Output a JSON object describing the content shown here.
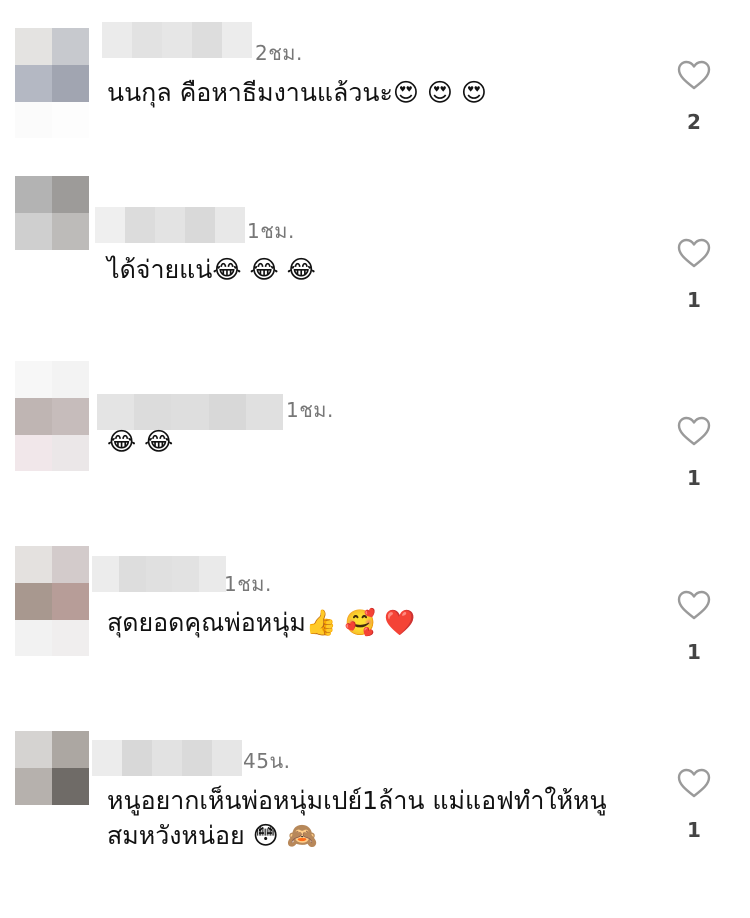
{
  "comments": [
    {
      "time": "2ชม.",
      "text": "นนกุล คือหาธีมงานแล้วนะ😍 😍 😍",
      "likes": "2",
      "avatar_colors": [
        "#e4e3e1",
        "#c7c9ce",
        "#b4b8c3",
        "#a1a5b1",
        "#fbfbfb",
        "#fdfdfd"
      ],
      "name_colors": [
        "#ebebeb",
        "#e2e2e2",
        "#e6e6e6",
        "#dddddd",
        "#ececec"
      ]
    },
    {
      "time": "1ชม.",
      "text": "ได้จ่ายแน่😂 😂 😂",
      "likes": "1",
      "avatar_colors": [
        "#b3b3b3",
        "#9d9b99",
        "#cfcfcf",
        "#bdbbb9",
        "#ffffff",
        "#ffffff"
      ],
      "name_colors": [
        "#efefef",
        "#dcdcdc",
        "#e3e3e3",
        "#d9d9d9",
        "#e8e8e8"
      ]
    },
    {
      "time": "1ชม.",
      "text": "😂 😂",
      "likes": "1",
      "avatar_colors": [
        "#f7f7f7",
        "#f3f3f3",
        "#bfb5b3",
        "#c6bcbb",
        "#f1e7ea",
        "#ebe7e8"
      ],
      "name_colors": [
        "#e4e4e4",
        "#dcdcdc",
        "#dedede",
        "#d8d8d8",
        "#e0e0e0"
      ]
    },
    {
      "time": "1ชม.",
      "text": "สุดยอดคุณพ่อหนุ่ม👍 🥰 ❤️",
      "likes": "1",
      "avatar_colors": [
        "#e4e1df",
        "#d3cbcb",
        "#a8988f",
        "#b79d98",
        "#f2f2f2",
        "#f0eeee"
      ],
      "name_colors": [
        "#ececec",
        "#dddddd",
        "#e0e0e0",
        "#e2e2e2",
        "#eaeaea"
      ]
    },
    {
      "time": "45น.",
      "text_lines": [
        "หนูอยากเห็นพ่อหนุ่มเปย์1ล้าน แม่แอฟทำให้หนู",
        "สมหวังหน่อย 😳 🙈"
      ],
      "likes": "1",
      "avatar_colors": [
        "#d5d3d1",
        "#aca7a2",
        "#b6b1ad",
        "#6f6b67",
        "#ffffff",
        "#ffffff"
      ],
      "name_colors": [
        "#ececec",
        "#d8d8d8",
        "#e2e2e2",
        "#dadada",
        "#e6e6e6"
      ]
    }
  ],
  "icons": {
    "like": "heart-outline-icon"
  },
  "colors": {
    "time": "#777777",
    "heart": "#9a9a9a",
    "count": "#444444"
  }
}
